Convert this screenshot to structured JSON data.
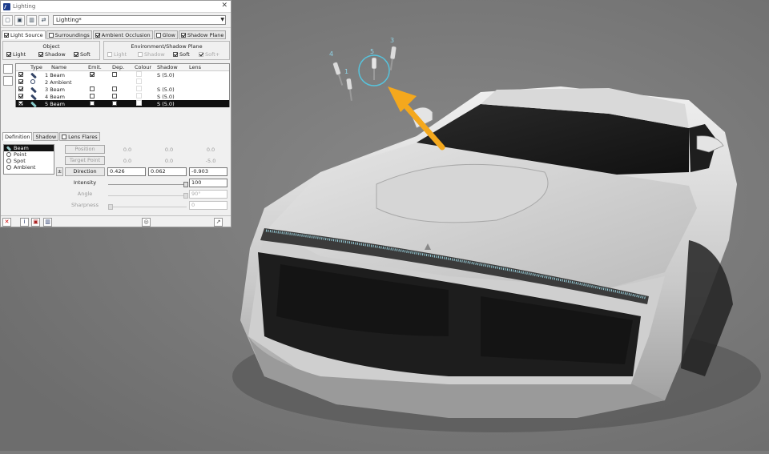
{
  "window": {
    "title": "Lighting"
  },
  "toolbar": {
    "preset_value": "Lighting*"
  },
  "tabs": [
    {
      "label": "Light Source",
      "checked": true,
      "active": true
    },
    {
      "label": "Surroundings",
      "checked": false
    },
    {
      "label": "Ambient Occlusion",
      "checked": true
    },
    {
      "label": "Glow",
      "checked": false
    },
    {
      "label": "Shadow Plane",
      "checked": true
    }
  ],
  "object_group": {
    "title": "Object",
    "options": [
      {
        "label": "Light",
        "checked": true
      },
      {
        "label": "Shadow",
        "checked": true
      },
      {
        "label": "Soft",
        "checked": true
      }
    ]
  },
  "env_group": {
    "title": "Environment/Shadow Plane",
    "options": [
      {
        "label": "Light",
        "checked": false
      },
      {
        "label": "Shadow",
        "checked": false
      },
      {
        "label": "Soft",
        "checked": true
      },
      {
        "label": "Soft+",
        "checked": true
      }
    ]
  },
  "table": {
    "headers": [
      "Type",
      "Name",
      "Emit.",
      "Dep.",
      "Colour",
      "Shadow",
      "Lens"
    ],
    "rows": [
      {
        "name": "1 Beam",
        "type": "beam",
        "emit": true,
        "dep": false,
        "shadow": "S (5.0)"
      },
      {
        "name": "2 Ambient",
        "type": "ambient",
        "emit": null,
        "dep": null,
        "shadow": ""
      },
      {
        "name": "3 Beam",
        "type": "beam",
        "emit": false,
        "dep": false,
        "shadow": "S (5.0)"
      },
      {
        "name": "4 Beam",
        "type": "beam",
        "emit": false,
        "dep": false,
        "shadow": "S (5.0)"
      },
      {
        "name": "5 Beam",
        "type": "beam",
        "emit": false,
        "dep": false,
        "shadow": "S (5.0)",
        "selected": true
      }
    ]
  },
  "def_tabs": [
    {
      "label": "Definition",
      "active": true
    },
    {
      "label": "Shadow"
    },
    {
      "label": "Lens Flares",
      "checked": false
    }
  ],
  "light_types": [
    {
      "label": "Beam",
      "selected": true
    },
    {
      "label": "Point"
    },
    {
      "label": "Spot"
    },
    {
      "label": "Ambient"
    }
  ],
  "params": {
    "position": {
      "label": "Position",
      "x": "0.0",
      "y": "0.0",
      "z": "0.0"
    },
    "target": {
      "label": "Target Point",
      "x": "0.0",
      "y": "0.0",
      "z": "-5.0"
    },
    "direction": {
      "label": "Direction",
      "sign": "±",
      "x": "0.426",
      "y": "0.062",
      "z": "-0.903"
    },
    "intensity": {
      "label": "Intensity",
      "value": "100"
    },
    "angle": {
      "label": "Angle",
      "value": "90°"
    },
    "sharpness": {
      "label": "Sharpness",
      "value": "0"
    }
  },
  "lights": [
    {
      "label": "1"
    },
    {
      "label": "3"
    },
    {
      "label": "4"
    },
    {
      "label": "5"
    }
  ],
  "colors": {
    "arrow": "#f4a81d",
    "highlight": "#57c3dc",
    "background": "#7b7b7b"
  }
}
